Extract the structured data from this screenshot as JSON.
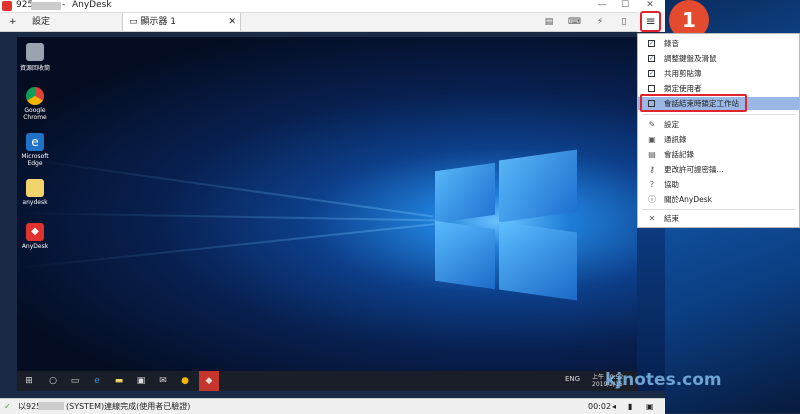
{
  "window": {
    "session_id": "925",
    "app_name": "AnyDesk",
    "title_sep": "-"
  },
  "tabs": [
    {
      "label": "設定"
    },
    {
      "label": "顯示器 1"
    }
  ],
  "tab_add": "+",
  "menu_button_glyph": "≡",
  "badge_number": "1",
  "menu": {
    "items": [
      {
        "label": "錄音",
        "checked": true
      },
      {
        "label": "調整鍵盤及滑鼠",
        "checked": true
      },
      {
        "label": "共用剪貼簿",
        "checked": true
      },
      {
        "label": "鎖定使用者",
        "checked": false
      },
      {
        "label": "會話結束時鎖定工作站",
        "checked": false,
        "highlighted": true
      },
      {
        "label": "設定",
        "icon": "wrench-icon"
      },
      {
        "label": "通訊錄",
        "icon": "address-book-icon"
      },
      {
        "label": "會話記錄",
        "icon": "session-log-icon"
      },
      {
        "label": "更改許可證密鑰...",
        "icon": "key-icon"
      },
      {
        "label": "協助",
        "icon": "help-icon"
      },
      {
        "label": "關於AnyDesk",
        "icon": "info-icon"
      },
      {
        "label": "結束",
        "icon": "close-icon"
      }
    ]
  },
  "desktop_icons": [
    {
      "label": "資源回收筒"
    },
    {
      "label": "Google Chrome"
    },
    {
      "label": "Microsoft Edge"
    },
    {
      "label": "anydesk"
    },
    {
      "label": "AnyDesk"
    }
  ],
  "taskbar": {
    "lang": "ENG",
    "time": "上午 10:52",
    "date": "2019/2/15"
  },
  "status": {
    "prefix": "以925",
    "text": "(SYSTEM)連線完成(使用者已驗證)",
    "timer": "00:02"
  },
  "watermark": "kjnotes.com",
  "colors": {
    "accent": "#e0242c",
    "badge": "#e34a2e",
    "highlight": "#9bb7e6"
  }
}
